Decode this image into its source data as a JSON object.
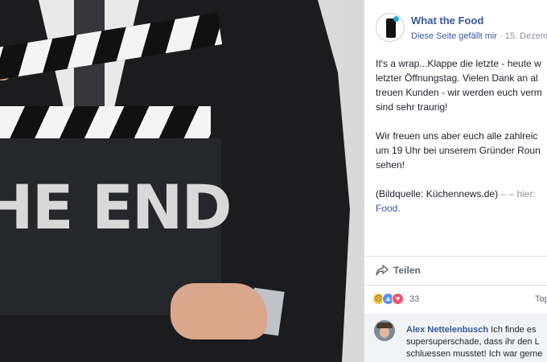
{
  "photo": {
    "board_text": "HE END"
  },
  "post": {
    "page_name": "What the Food",
    "like_page_link": "Diese Seite gefällt mir",
    "separator": " · ",
    "date": "15. Dezem",
    "paragraph1": "It's a wrap...Klappe die letzte - heute w\nletzter Öffnungstag. Vielen Dank an al\ntreuen Kunden - wir werden euch verm\nsind sehr traurig!",
    "paragraph2": "Wir freuen uns aber euch alle zahlreic\num 19 Uhr bei unserem Gründer Roun\nsehen!",
    "source_text": "(Bildquelle: Küchennews.de)",
    "source_dash": " – – hier:",
    "source_link": "Food."
  },
  "actions": {
    "share_label": "Teilen"
  },
  "reactions": {
    "count": "33",
    "top_comments_label": "Top"
  },
  "comment": {
    "author": "Alex Nettelenbusch",
    "text": " Ich finde es supersuperschade, dass ihr den L schluessen musstet! Ich war gerne"
  }
}
